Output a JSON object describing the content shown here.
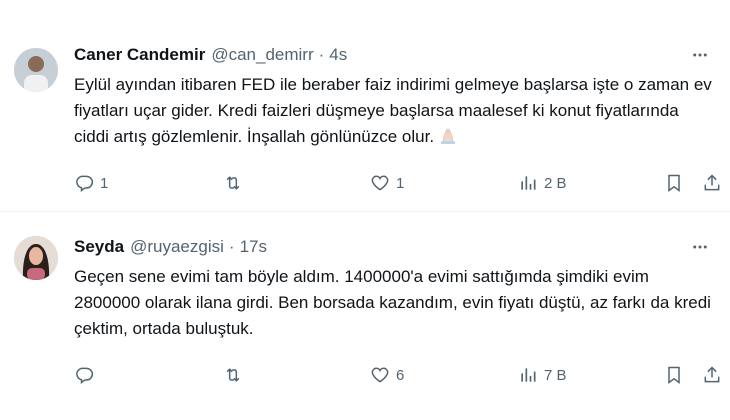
{
  "tweets": [
    {
      "name": "Caner Candemir",
      "handle": "@can_demirr",
      "dot": "·",
      "time": "4s",
      "text": "Eylül ayından itibaren FED ile beraber faiz indirimi gelmeye başlarsa işte o zaman ev fiyatları uçar gider. Kredi faizleri düşmeye başlarsa maalesef ki konut fiyatlarında ciddi artış gözlemlenir. İnşallah gönlünüzce olur.",
      "emoji_icon": "folded-hands-icon",
      "replies": "1",
      "retweets": "",
      "likes": "1",
      "views": "2 B"
    },
    {
      "name": "Seyda",
      "handle": "@ruyaezgisi",
      "dot": "·",
      "time": "17s",
      "text": "Geçen sene evimi tam böyle aldım. 1400000'a evimi sattığımda şimdiki evim 2800000 olarak ilana girdi. Ben borsada kazandım, evin fiyatı düştü, az farkı da kredi çektim, ortada buluştuk.",
      "replies": "",
      "retweets": "",
      "likes": "6",
      "views": "7 B"
    }
  ],
  "icons": {
    "reply": "reply-icon",
    "retweet": "retweet-icon",
    "like": "heart-icon",
    "views": "views-chart-icon",
    "bookmark": "bookmark-icon",
    "share": "share-icon",
    "more": "more-dots-icon"
  },
  "colors": {
    "text": "#0f1419",
    "secondary": "#536471",
    "divider": "#eff3f4"
  }
}
